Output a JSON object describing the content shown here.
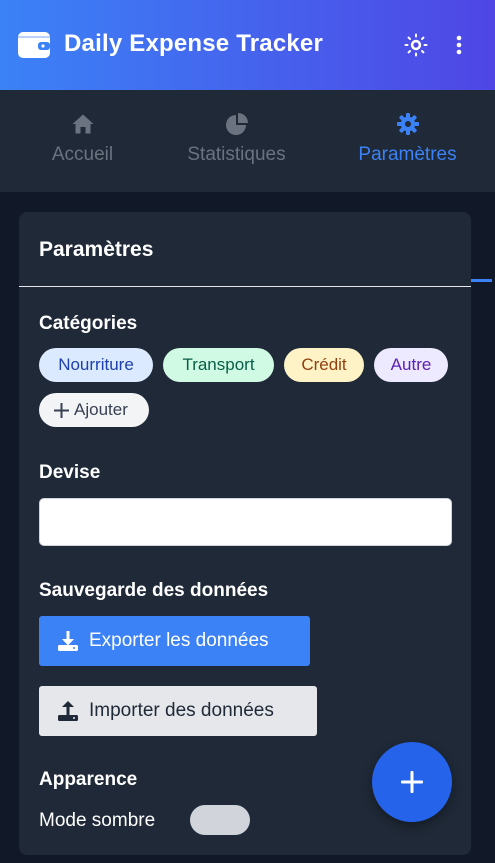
{
  "header": {
    "title": "Daily Expense Tracker",
    "icons": {
      "logo": "wallet-icon",
      "theme": "sun-icon",
      "menu": "more-vertical-icon"
    }
  },
  "tabs": [
    {
      "label": "Accueil",
      "icon": "home-icon",
      "active": false
    },
    {
      "label": "Statistiques",
      "icon": "pie-chart-icon",
      "active": false
    },
    {
      "label": "Paramètres",
      "icon": "gear-icon",
      "active": true
    }
  ],
  "settings": {
    "title": "Paramètres",
    "categories": {
      "label": "Catégories",
      "items": [
        {
          "label": "Nourriture",
          "bg": "#dbeafe",
          "fg": "#1e40af"
        },
        {
          "label": "Transport",
          "bg": "#d1fae5",
          "fg": "#065f46"
        },
        {
          "label": "Crédit",
          "bg": "#fef3c7",
          "fg": "#92400e"
        },
        {
          "label": "Autre",
          "bg": "#ede9fe",
          "fg": "#5b21b6"
        }
      ],
      "add_label": "Ajouter"
    },
    "currency": {
      "label": "Devise",
      "value": ""
    },
    "backup": {
      "label": "Sauvegarde des données",
      "export_label": "Exporter les données",
      "import_label": "Importer des données"
    },
    "appearance": {
      "label": "Apparence",
      "dark_mode_label": "Mode sombre",
      "dark_mode_on": false
    }
  },
  "colors": {
    "accent": "#3b82f6",
    "header_gradient_start": "#3b82f6",
    "header_gradient_end": "#4f46e5",
    "background": "#111827",
    "surface": "#1f2937"
  }
}
